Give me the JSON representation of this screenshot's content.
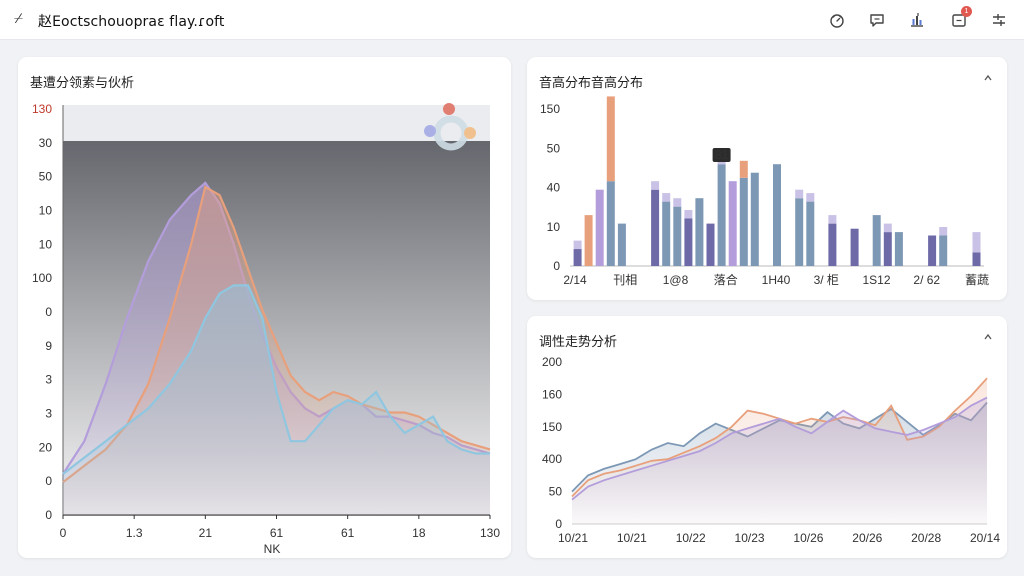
{
  "app": {
    "mark": "⌿",
    "title": "赵Eoctschouopraε flay.ɾoft"
  },
  "toolbar": {
    "notification_count": "1"
  },
  "colors": {
    "purple": "#b39ddb",
    "orange": "#e8a07c",
    "blue": "#8fc6e0",
    "slate": "#7d98b5",
    "indigo": "#6e6aa8",
    "dark_panel": "#5d5f66"
  },
  "panels": {
    "left": {
      "title": "基遭分领素与伙析"
    },
    "top_right": {
      "title": "音高分布音高分布"
    },
    "bottom_right": {
      "title": "调性走势分析"
    }
  },
  "chart_data": [
    {
      "type": "area",
      "x_ticks": [
        "0",
        "1.3",
        "21",
        "61",
        "61",
        "18",
        "130"
      ],
      "x_tick_values": [
        0,
        20,
        40,
        60,
        80,
        100,
        120
      ],
      "y_ticks": [
        "130",
        "30",
        "50",
        "10",
        "10",
        "100",
        "0",
        "9",
        "3",
        "3",
        "20",
        "0",
        "0"
      ],
      "xlabel": "NK",
      "ylim": [
        0,
        100
      ],
      "xlim": [
        0,
        120
      ],
      "series": [
        {
          "color": "#b39ddb",
          "x": [
            0,
            6,
            12,
            18,
            24,
            30,
            36,
            40,
            44,
            48,
            52,
            56,
            60,
            64,
            68,
            72,
            76,
            80,
            84,
            88,
            92,
            96,
            100,
            104,
            108,
            112,
            116,
            120
          ],
          "y": [
            10,
            18,
            32,
            48,
            62,
            72,
            78,
            81,
            76,
            66,
            54,
            44,
            36,
            30,
            26,
            24,
            26,
            28,
            27,
            24,
            24,
            23,
            22,
            20,
            19,
            17,
            16,
            15
          ]
        },
        {
          "color": "#e8a07c",
          "x": [
            0,
            6,
            12,
            18,
            24,
            30,
            36,
            40,
            44,
            48,
            52,
            56,
            60,
            64,
            68,
            72,
            76,
            80,
            84,
            88,
            92,
            96,
            100,
            104,
            108,
            112,
            116,
            120
          ],
          "y": [
            8,
            12,
            16,
            22,
            32,
            48,
            66,
            80,
            78,
            70,
            60,
            50,
            42,
            34,
            30,
            28,
            30,
            29,
            27,
            26,
            25,
            25,
            24,
            22,
            20,
            18,
            17,
            16
          ]
        },
        {
          "color": "#8fc6e0",
          "x": [
            0,
            6,
            12,
            18,
            24,
            30,
            36,
            40,
            44,
            48,
            52,
            56,
            60,
            64,
            68,
            72,
            76,
            80,
            84,
            88,
            92,
            96,
            100,
            104,
            108,
            112,
            116,
            120
          ],
          "y": [
            10,
            14,
            18,
            22,
            26,
            32,
            40,
            48,
            54,
            56,
            56,
            48,
            30,
            18,
            18,
            22,
            26,
            28,
            27,
            30,
            24,
            20,
            22,
            24,
            18,
            16,
            15,
            15
          ]
        }
      ]
    },
    {
      "type": "bar",
      "x_ticks": [
        "2/14",
        "刊相",
        "1@8",
        "落合",
        "1H40",
        "3/ 柜",
        "1S12",
        "2/ 62",
        "蓄蔬"
      ],
      "y_ticks": [
        "150",
        "50",
        "40",
        "10",
        "0"
      ],
      "ylim": [
        0,
        150
      ],
      "annotation": "81",
      "series": [
        {
          "color": "#6e6aa8",
          "values": [
            10,
            0,
            0,
            0,
            0,
            0,
            0,
            45,
            0,
            0,
            28,
            0,
            25,
            0,
            0,
            0,
            0,
            0,
            0,
            0,
            0,
            0,
            0,
            25,
            0,
            22,
            0,
            0,
            20,
            0,
            0,
            0,
            18,
            0,
            0,
            0,
            8
          ]
        },
        {
          "color": "#b39ddb",
          "values": [
            0,
            0,
            45,
            0,
            0,
            0,
            0,
            0,
            0,
            0,
            0,
            0,
            0,
            0,
            50,
            0,
            0,
            0,
            0,
            0,
            0,
            0,
            0,
            0,
            0,
            0,
            0,
            0,
            0,
            0,
            0,
            0,
            0,
            0,
            0,
            0,
            0
          ]
        },
        {
          "color": "#7d98b5",
          "values": [
            0,
            0,
            0,
            50,
            25,
            0,
            0,
            0,
            38,
            35,
            0,
            40,
            0,
            60,
            0,
            52,
            55,
            0,
            60,
            0,
            40,
            38,
            0,
            0,
            0,
            0,
            0,
            30,
            0,
            20,
            0,
            0,
            0,
            18,
            0,
            0,
            0
          ]
        },
        {
          "color": "#e8a07c",
          "values": [
            0,
            30,
            0,
            50,
            0,
            0,
            0,
            0,
            0,
            0,
            0,
            0,
            0,
            0,
            0,
            10,
            0,
            0,
            0,
            0,
            0,
            0,
            0,
            0,
            0,
            0,
            0,
            0,
            0,
            0,
            0,
            0,
            0,
            0,
            0,
            0,
            0
          ]
        },
        {
          "color": "#c9c2e6",
          "values": [
            5,
            0,
            0,
            0,
            0,
            0,
            0,
            5,
            5,
            5,
            5,
            0,
            0,
            5,
            0,
            0,
            0,
            0,
            0,
            0,
            5,
            5,
            0,
            5,
            0,
            0,
            0,
            0,
            5,
            0,
            0,
            0,
            0,
            5,
            0,
            0,
            12
          ]
        }
      ]
    },
    {
      "type": "area",
      "x_ticks": [
        "10/21",
        "10/21",
        "10/22",
        "10/23",
        "10/26",
        "20/26",
        "20/28",
        "20/14"
      ],
      "y_ticks": [
        "200",
        "160",
        "150",
        "400",
        "50",
        "0"
      ],
      "ylim": [
        0,
        200
      ],
      "series": [
        {
          "color": "#7d98b5",
          "values": [
            40,
            60,
            68,
            74,
            80,
            92,
            100,
            96,
            112,
            124,
            116,
            108,
            118,
            128,
            124,
            120,
            138,
            124,
            118,
            130,
            142,
            126,
            110,
            122,
            136,
            128,
            150
          ]
        },
        {
          "color": "#e8a07c",
          "values": [
            34,
            54,
            62,
            66,
            72,
            78,
            80,
            88,
            96,
            106,
            120,
            140,
            136,
            130,
            124,
            130,
            126,
            132,
            128,
            122,
            146,
            104,
            108,
            120,
            140,
            158,
            180
          ]
        },
        {
          "color": "#b39ddb",
          "values": [
            30,
            46,
            54,
            60,
            66,
            72,
            78,
            84,
            90,
            100,
            112,
            118,
            124,
            130,
            120,
            112,
            126,
            140,
            128,
            118,
            114,
            110,
            116,
            124,
            132,
            146,
            156
          ]
        }
      ]
    }
  ]
}
